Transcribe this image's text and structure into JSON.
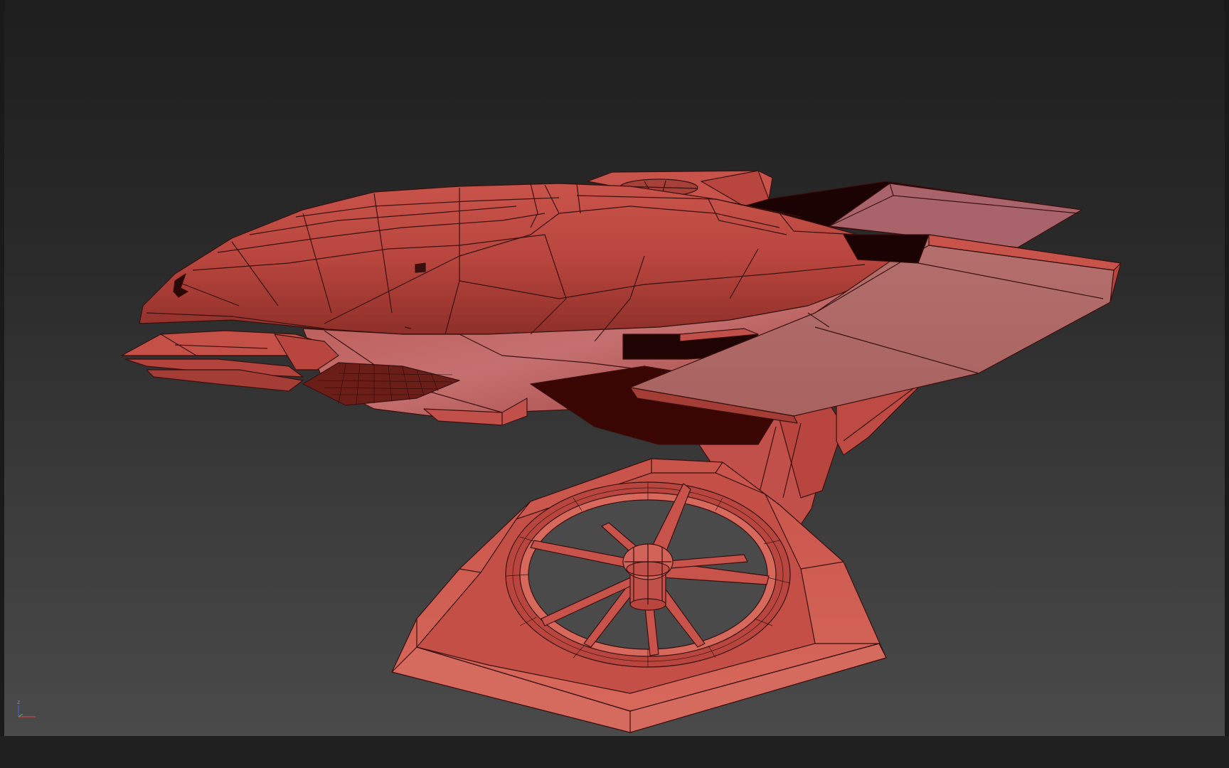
{
  "viewport": {
    "name": "3d-perspective-viewport",
    "model_color": "#c9554a",
    "wire_color": "#3a0f0d",
    "background_top": "#1e1e1e",
    "background_bottom": "#4a4a4a"
  },
  "axis_gizmo": {
    "z_label": "z",
    "x_color": "#d04040",
    "y_color": "#40b040",
    "z_color": "#4060d0"
  }
}
